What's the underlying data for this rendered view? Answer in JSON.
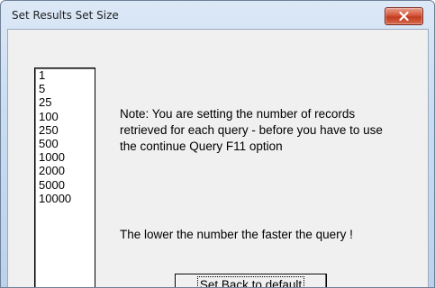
{
  "window": {
    "title": "Set Results Set Size",
    "close_icon": "close-icon"
  },
  "list": {
    "items": [
      "1",
      "5",
      "25",
      "100",
      "250",
      "500",
      "1000",
      "2000",
      "5000",
      "10000"
    ]
  },
  "note_text": "Note: You are setting the number of records retrieved for each query - before you have to use the continue Query F11 option",
  "lower_text": "The lower the number the faster the query !",
  "default_button_label": "Set Back to default"
}
